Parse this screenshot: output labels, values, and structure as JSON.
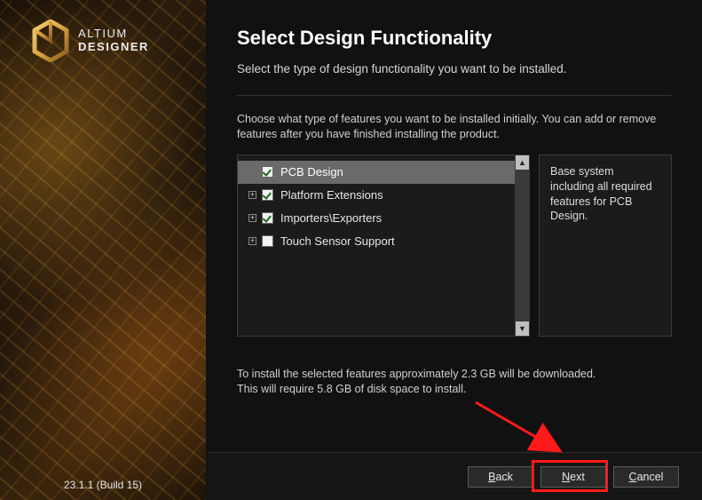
{
  "brand": {
    "line1": "ALTIUM",
    "line2": "DESIGNER"
  },
  "version": "23.1.1 (Build 15)",
  "header": {
    "title": "Select Design Functionality",
    "subtitle": "Select the type of design functionality you want to be installed."
  },
  "intro": "Choose what type of features you want to be installed initially. You can add or remove features after you have finished installing the product.",
  "features": {
    "items": [
      {
        "label": "PCB Design",
        "checked": true,
        "expandable": false,
        "selected": true
      },
      {
        "label": "Platform Extensions",
        "checked": true,
        "expandable": true,
        "selected": false
      },
      {
        "label": "Importers\\Exporters",
        "checked": true,
        "expandable": true,
        "selected": false
      },
      {
        "label": "Touch Sensor Support",
        "checked": false,
        "expandable": true,
        "selected": false
      }
    ],
    "description": "Base system including all required features for PCB Design."
  },
  "size_info": {
    "line1": "To install the selected features approximately 2.3 GB will be downloaded.",
    "line2": "This will require 5.8 GB of disk space to install."
  },
  "buttons": {
    "back": {
      "accel": "B",
      "rest": "ack"
    },
    "next": {
      "accel": "N",
      "rest": "ext"
    },
    "cancel": {
      "accel": "C",
      "rest": "ancel"
    }
  }
}
